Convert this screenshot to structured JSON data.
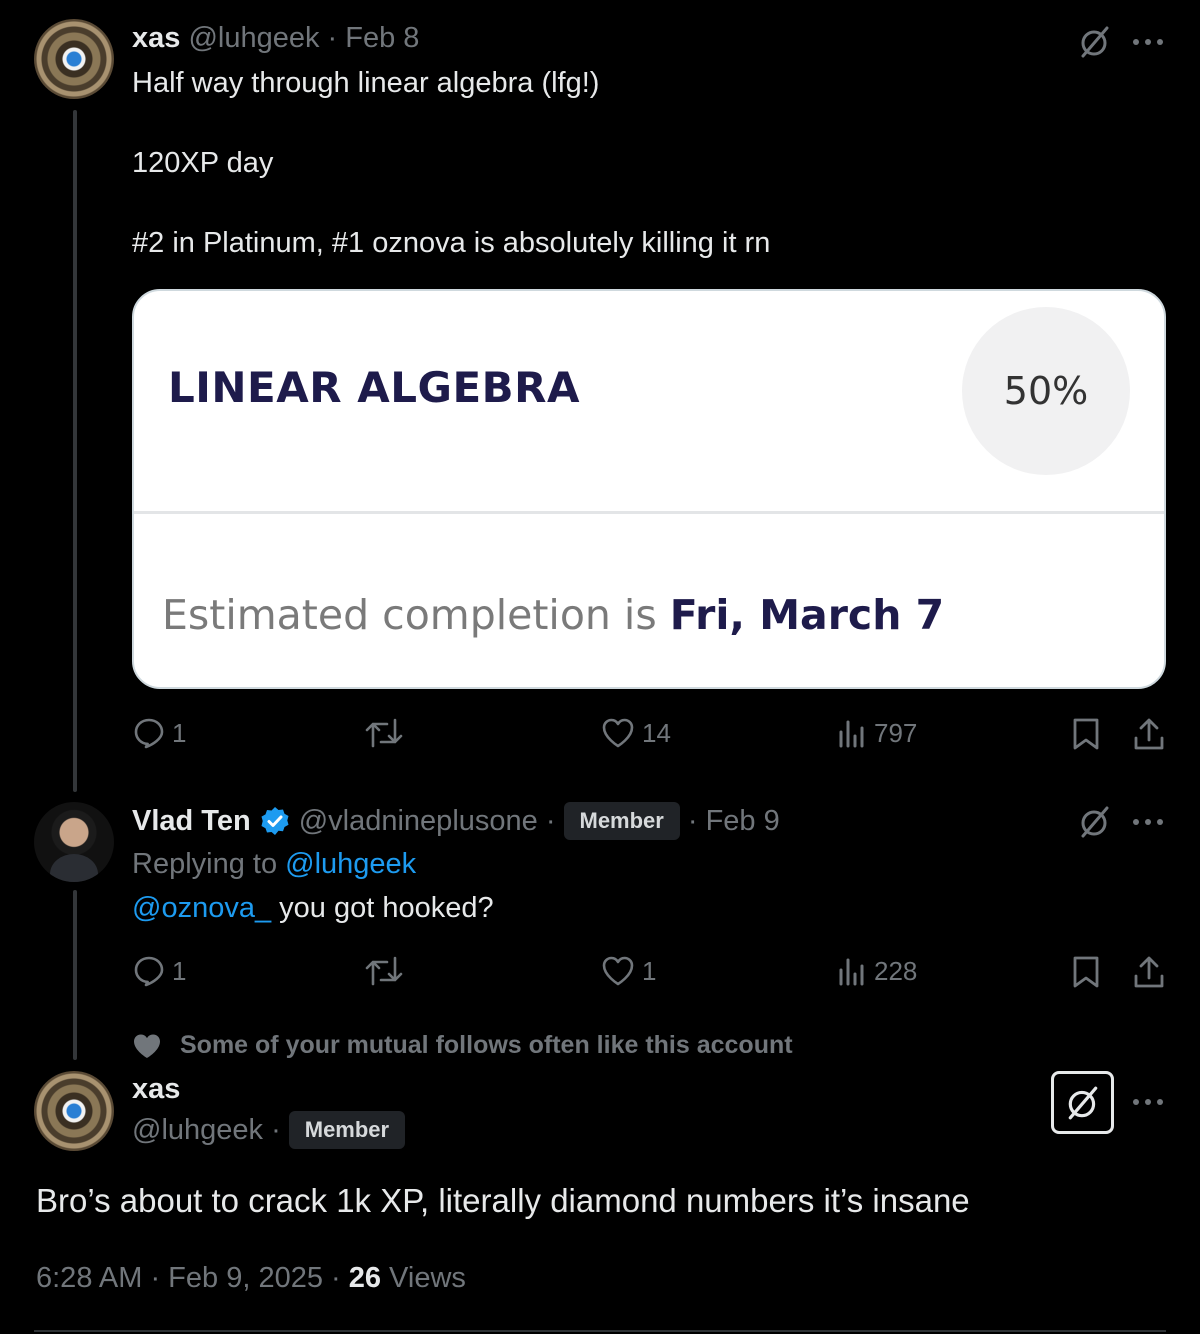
{
  "tweet1": {
    "name": "xas",
    "handle": "@luhgeek",
    "date": "· Feb 8",
    "lines": [
      "Half way through linear algebra (lfg!)",
      "120XP day",
      "#2 in Platinum, #1 oznova is absolutely killing it rn"
    ],
    "card": {
      "title": "LINEAR ALGEBRA",
      "percent": "50%",
      "completion_prefix": "Estimated completion is ",
      "completion_date": "Fri, March 7"
    },
    "actions": {
      "replies": "1",
      "likes": "14",
      "views": "797"
    }
  },
  "tweet2": {
    "name": "Vlad Ten",
    "handle": "@vladnineplusone ·",
    "badge": "Member",
    "date": "· Feb 9",
    "replying_prefix": "Replying to ",
    "replying_handle": "@luhgeek",
    "mention": "@oznova_",
    "text": " you got hooked?",
    "actions": {
      "replies": "1",
      "likes": "1",
      "views": "228"
    }
  },
  "social_context": "Some of your mutual follows often like this account",
  "tweet3": {
    "name": "xas",
    "handle": "@luhgeek ·",
    "badge": "Member",
    "text": "Bro’s about to crack 1k XP, literally diamond numbers it’s insane",
    "time": "6:28 AM · Feb 9, 2025 · ",
    "views_count": "26",
    "views_label": " Views"
  },
  "icons": {
    "more": "more-icon",
    "grok": "grok-icon",
    "reply": "reply-icon",
    "retweet": "retweet-icon",
    "like": "like-icon",
    "views": "views-icon",
    "bookmark": "bookmark-icon",
    "share": "share-icon",
    "verified": "verified-badge-icon",
    "heart": "heart-icon"
  },
  "colors": {
    "accent": "#1d9bf0",
    "muted": "#71767b",
    "card_title": "#1e1b4b"
  }
}
